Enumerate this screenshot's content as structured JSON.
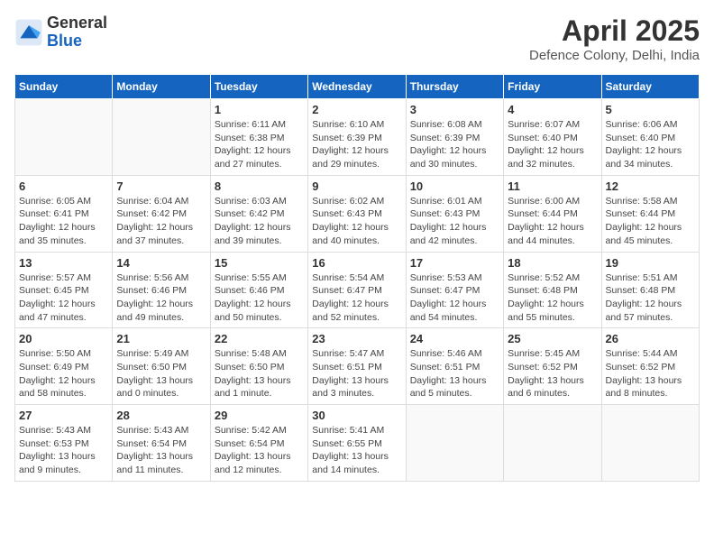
{
  "header": {
    "logo_general": "General",
    "logo_blue": "Blue",
    "main_title": "April 2025",
    "subtitle": "Defence Colony, Delhi, India"
  },
  "days_of_week": [
    "Sunday",
    "Monday",
    "Tuesday",
    "Wednesday",
    "Thursday",
    "Friday",
    "Saturday"
  ],
  "weeks": [
    [
      {
        "day": "",
        "info": ""
      },
      {
        "day": "",
        "info": ""
      },
      {
        "day": "1",
        "info": "Sunrise: 6:11 AM\nSunset: 6:38 PM\nDaylight: 12 hours and 27 minutes."
      },
      {
        "day": "2",
        "info": "Sunrise: 6:10 AM\nSunset: 6:39 PM\nDaylight: 12 hours and 29 minutes."
      },
      {
        "day": "3",
        "info": "Sunrise: 6:08 AM\nSunset: 6:39 PM\nDaylight: 12 hours and 30 minutes."
      },
      {
        "day": "4",
        "info": "Sunrise: 6:07 AM\nSunset: 6:40 PM\nDaylight: 12 hours and 32 minutes."
      },
      {
        "day": "5",
        "info": "Sunrise: 6:06 AM\nSunset: 6:40 PM\nDaylight: 12 hours and 34 minutes."
      }
    ],
    [
      {
        "day": "6",
        "info": "Sunrise: 6:05 AM\nSunset: 6:41 PM\nDaylight: 12 hours and 35 minutes."
      },
      {
        "day": "7",
        "info": "Sunrise: 6:04 AM\nSunset: 6:42 PM\nDaylight: 12 hours and 37 minutes."
      },
      {
        "day": "8",
        "info": "Sunrise: 6:03 AM\nSunset: 6:42 PM\nDaylight: 12 hours and 39 minutes."
      },
      {
        "day": "9",
        "info": "Sunrise: 6:02 AM\nSunset: 6:43 PM\nDaylight: 12 hours and 40 minutes."
      },
      {
        "day": "10",
        "info": "Sunrise: 6:01 AM\nSunset: 6:43 PM\nDaylight: 12 hours and 42 minutes."
      },
      {
        "day": "11",
        "info": "Sunrise: 6:00 AM\nSunset: 6:44 PM\nDaylight: 12 hours and 44 minutes."
      },
      {
        "day": "12",
        "info": "Sunrise: 5:58 AM\nSunset: 6:44 PM\nDaylight: 12 hours and 45 minutes."
      }
    ],
    [
      {
        "day": "13",
        "info": "Sunrise: 5:57 AM\nSunset: 6:45 PM\nDaylight: 12 hours and 47 minutes."
      },
      {
        "day": "14",
        "info": "Sunrise: 5:56 AM\nSunset: 6:46 PM\nDaylight: 12 hours and 49 minutes."
      },
      {
        "day": "15",
        "info": "Sunrise: 5:55 AM\nSunset: 6:46 PM\nDaylight: 12 hours and 50 minutes."
      },
      {
        "day": "16",
        "info": "Sunrise: 5:54 AM\nSunset: 6:47 PM\nDaylight: 12 hours and 52 minutes."
      },
      {
        "day": "17",
        "info": "Sunrise: 5:53 AM\nSunset: 6:47 PM\nDaylight: 12 hours and 54 minutes."
      },
      {
        "day": "18",
        "info": "Sunrise: 5:52 AM\nSunset: 6:48 PM\nDaylight: 12 hours and 55 minutes."
      },
      {
        "day": "19",
        "info": "Sunrise: 5:51 AM\nSunset: 6:48 PM\nDaylight: 12 hours and 57 minutes."
      }
    ],
    [
      {
        "day": "20",
        "info": "Sunrise: 5:50 AM\nSunset: 6:49 PM\nDaylight: 12 hours and 58 minutes."
      },
      {
        "day": "21",
        "info": "Sunrise: 5:49 AM\nSunset: 6:50 PM\nDaylight: 13 hours and 0 minutes."
      },
      {
        "day": "22",
        "info": "Sunrise: 5:48 AM\nSunset: 6:50 PM\nDaylight: 13 hours and 1 minute."
      },
      {
        "day": "23",
        "info": "Sunrise: 5:47 AM\nSunset: 6:51 PM\nDaylight: 13 hours and 3 minutes."
      },
      {
        "day": "24",
        "info": "Sunrise: 5:46 AM\nSunset: 6:51 PM\nDaylight: 13 hours and 5 minutes."
      },
      {
        "day": "25",
        "info": "Sunrise: 5:45 AM\nSunset: 6:52 PM\nDaylight: 13 hours and 6 minutes."
      },
      {
        "day": "26",
        "info": "Sunrise: 5:44 AM\nSunset: 6:52 PM\nDaylight: 13 hours and 8 minutes."
      }
    ],
    [
      {
        "day": "27",
        "info": "Sunrise: 5:43 AM\nSunset: 6:53 PM\nDaylight: 13 hours and 9 minutes."
      },
      {
        "day": "28",
        "info": "Sunrise: 5:43 AM\nSunset: 6:54 PM\nDaylight: 13 hours and 11 minutes."
      },
      {
        "day": "29",
        "info": "Sunrise: 5:42 AM\nSunset: 6:54 PM\nDaylight: 13 hours and 12 minutes."
      },
      {
        "day": "30",
        "info": "Sunrise: 5:41 AM\nSunset: 6:55 PM\nDaylight: 13 hours and 14 minutes."
      },
      {
        "day": "",
        "info": ""
      },
      {
        "day": "",
        "info": ""
      },
      {
        "day": "",
        "info": ""
      }
    ]
  ]
}
